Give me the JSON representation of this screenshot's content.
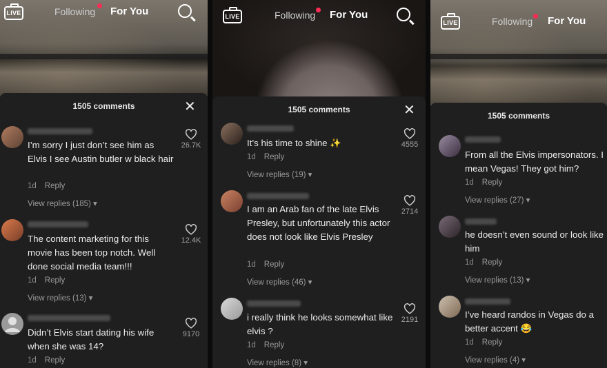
{
  "live_label": "LIVE",
  "nav": {
    "following": "Following",
    "for_you": "For You"
  },
  "comments_title": "1505 comments",
  "panels": [
    {
      "comments": [
        {
          "text": "I’m sorry I just don’t see him as Elvis I see Austin butler w black hair",
          "age": "1d",
          "reply": "Reply",
          "replies": "View replies (185)",
          "likes": "26.7K"
        },
        {
          "text": "The content marketing for this movie has been top notch. Well done social media team!!!",
          "age": "1d",
          "reply": "Reply",
          "replies": "View replies (13)",
          "likes": "12.4K"
        },
        {
          "text": "Didn’t Elvis start dating his wife when she was 14?",
          "age": "1d",
          "reply": "Reply",
          "replies": "",
          "likes": "9170"
        }
      ]
    },
    {
      "comments": [
        {
          "text": "It’s his time to shine ✨",
          "age": "1d",
          "reply": "Reply",
          "replies": "View replies (19)",
          "likes": "4555"
        },
        {
          "text": "I am an Arab fan of the late Elvis Presley, but unfortunately this actor does not look like Elvis Presley",
          "age": "1d",
          "reply": "Reply",
          "replies": "View replies (46)",
          "likes": "2714"
        },
        {
          "text": "i really think he looks somewhat like elvis ?",
          "age": "1d",
          "reply": "Reply",
          "replies": "View replies (8)",
          "likes": "2191"
        }
      ]
    },
    {
      "comments": [
        {
          "text": "From all the Elvis impersonators. I mean Vegas! They got him?",
          "age": "1d",
          "reply": "Reply",
          "replies": "View replies (27)"
        },
        {
          "text": "he doesn’t even sound or look like him",
          "age": "1d",
          "reply": "Reply",
          "replies": "View replies (13)"
        },
        {
          "text": "I’ve heard randos in Vegas do a better accent 😂",
          "age": "1d",
          "reply": "Reply",
          "replies": "View replies (4)"
        }
      ]
    }
  ],
  "icons": {
    "search": "search-icon",
    "close": "close-icon",
    "heart": "heart-icon",
    "live": "live-icon"
  },
  "colors": {
    "notification_dot": "#fe2c55",
    "sheet_bg": "#1f1f1f"
  }
}
